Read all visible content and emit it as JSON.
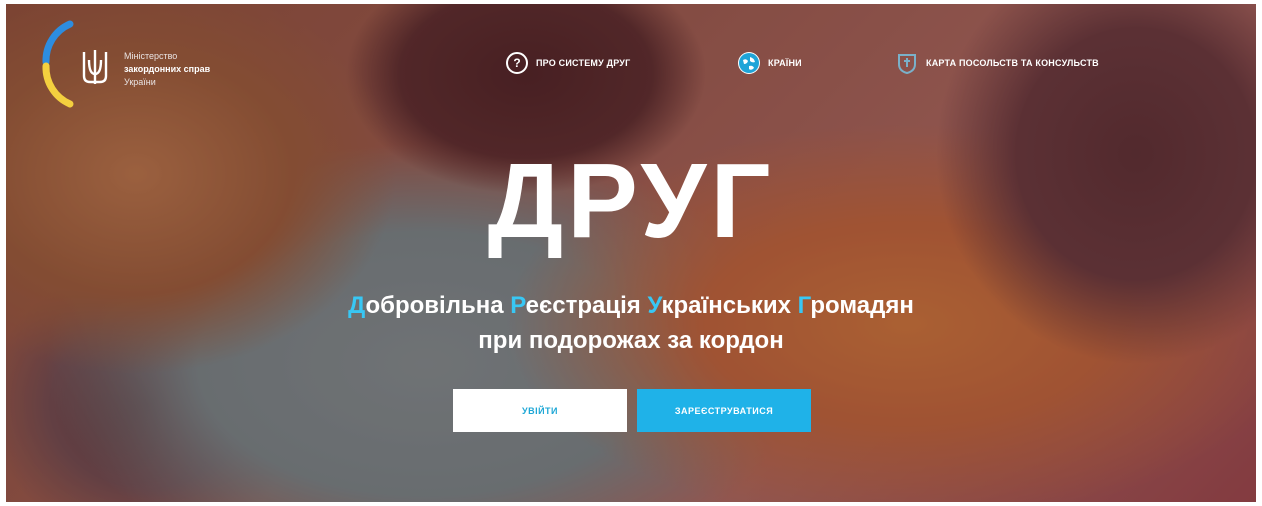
{
  "logo": {
    "line1": "Міністерство",
    "line2": "закордонних справ",
    "line3": "України"
  },
  "nav": {
    "items": [
      {
        "label": "ПРО СИСТЕМУ ДРУГ",
        "icon": "question-icon"
      },
      {
        "label": "КРАЇНИ",
        "icon": "globe-icon"
      },
      {
        "label": "КАРТА ПОСОЛЬСТВ ТА КОНСУЛЬСТВ",
        "icon": "map-shield-icon"
      }
    ]
  },
  "hero": {
    "title": "ДРУГ",
    "subtitle_line1": {
      "w1_first": "Д",
      "w1_rest": "обровільна ",
      "w2_first": "Р",
      "w2_rest": "еєстрація ",
      "w3_first": "У",
      "w3_rest": "країнських ",
      "w4_first": "Г",
      "w4_rest": "ромадян"
    },
    "subtitle_line2": "при подорожах за кордон"
  },
  "buttons": {
    "login": "УВІЙТИ",
    "register": "ЗАРЕЄСТРУВАТИСЯ"
  },
  "colors": {
    "accent_blue": "#1fb2e8",
    "highlight_blue": "#38c7f4",
    "overlay": "#781e28",
    "flag_yellow": "#f4d03f",
    "flag_blue": "#2d8de0"
  }
}
